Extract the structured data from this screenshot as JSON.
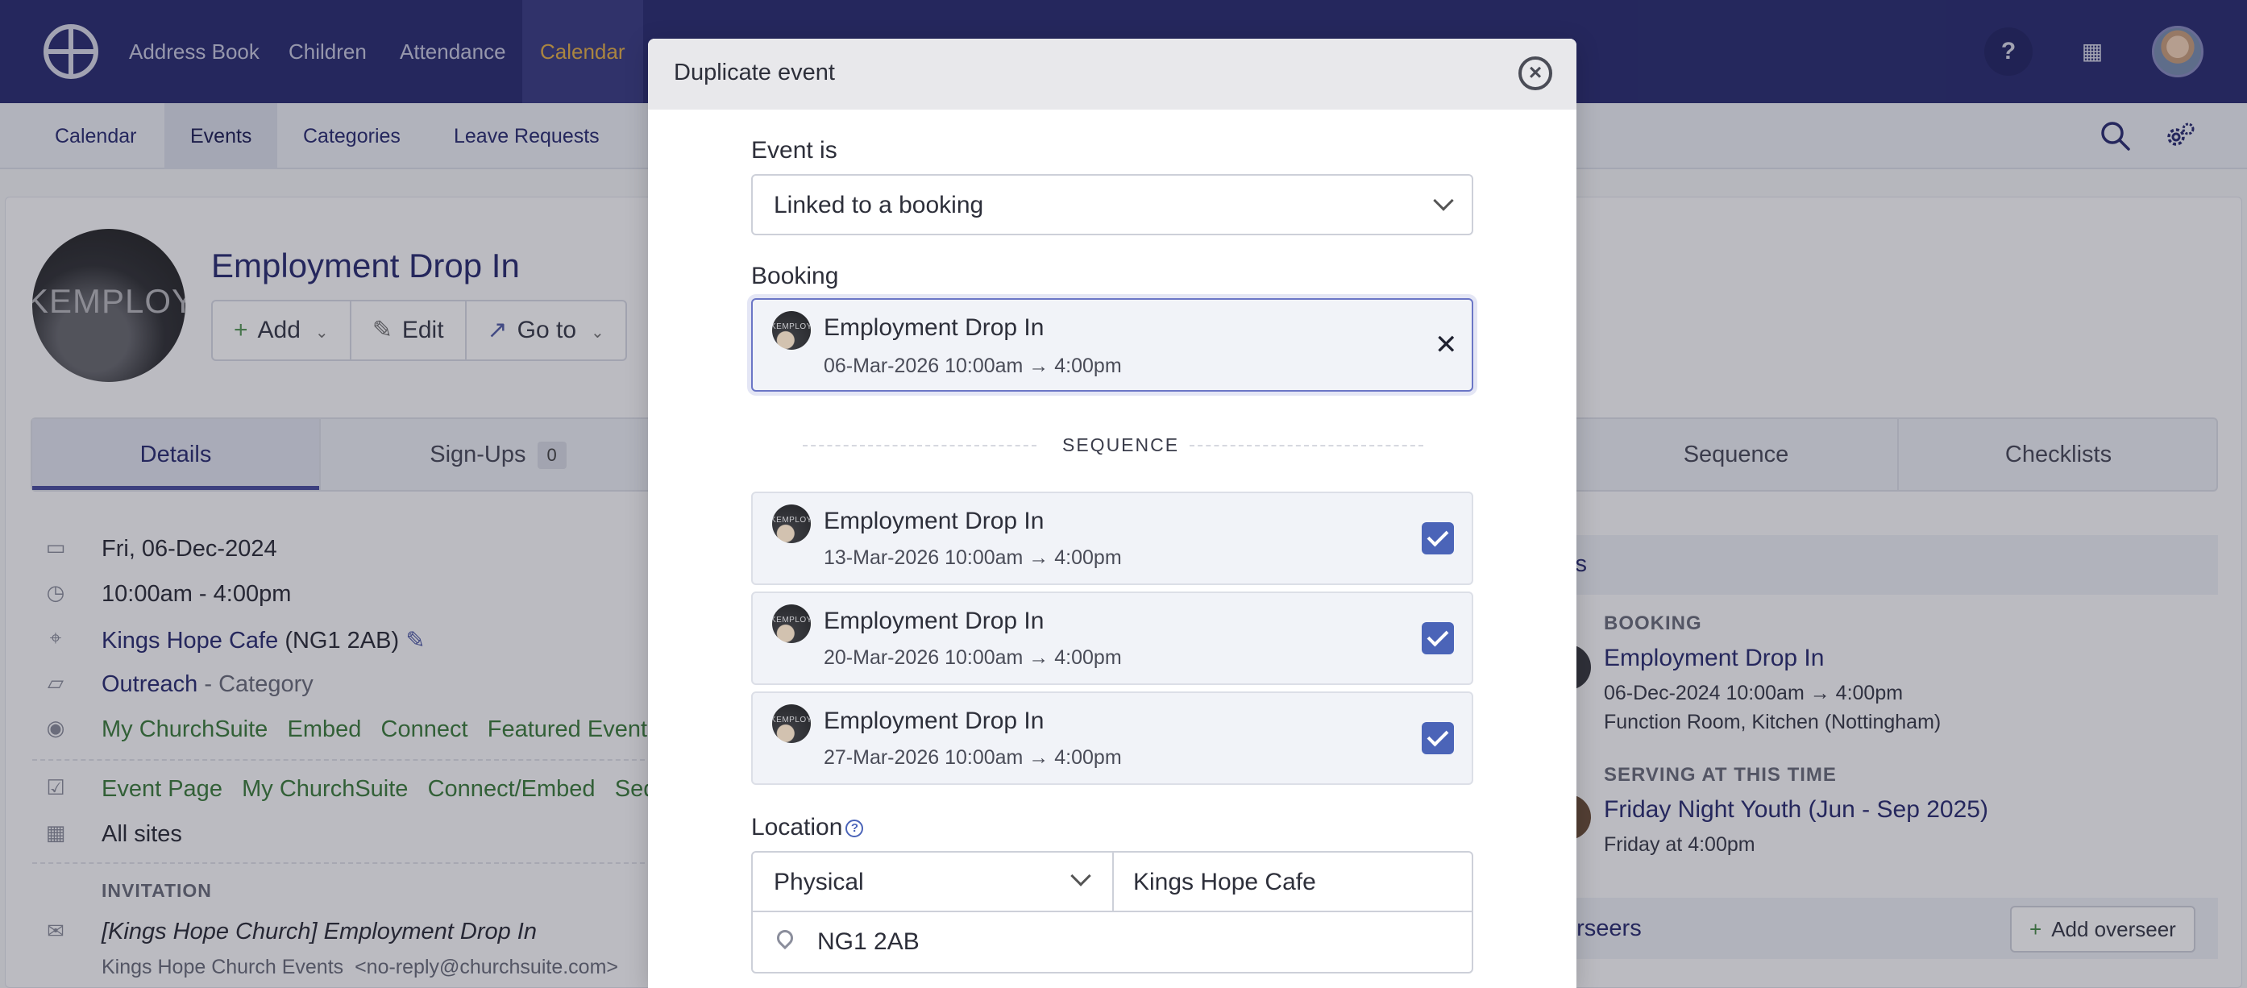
{
  "nav": {
    "items": [
      "Address Book",
      "Children",
      "Attendance",
      "Calendar"
    ],
    "active": "Calendar"
  },
  "subnav": {
    "items": [
      "Calendar",
      "Events",
      "Categories",
      "Leave Requests"
    ],
    "active": "Events"
  },
  "event": {
    "avatar_text": "KEMPLOYE",
    "title": "Employment Drop In",
    "buttons": {
      "add": "Add",
      "edit": "Edit",
      "goto": "Go to"
    }
  },
  "tabs": {
    "details": "Details",
    "signups": "Sign-Ups",
    "signups_count": "0",
    "sequence": "Sequence",
    "checklists": "Checklists"
  },
  "details": {
    "date": "Fri, 06-Dec-2024",
    "time": "10:00am - 4:00pm",
    "location_link": "Kings Hope Cafe",
    "location_postcode": "(NG1 2AB)",
    "category_link": "Outreach",
    "category_suffix": "- Category",
    "visibility": [
      "My ChurchSuite",
      "Embed",
      "Connect",
      "Featured Events"
    ],
    "publish": [
      "Event Page",
      "My ChurchSuite",
      "Connect/Embed",
      "Seq"
    ],
    "sites": "All sites",
    "invitation_label": "INVITATION",
    "invitation_subject": "[Kings Hope Church] Employment Drop In",
    "invitation_from": "Kings Hope Church Events",
    "invitation_email": "<no-reply@churchsuite.com>"
  },
  "right_panel": {
    "links_head": "ks",
    "booking_label": "BOOKING",
    "booking_title": "Employment Drop In",
    "booking_when": "06-Dec-2024 10:00am → 4:00pm",
    "booking_where": "Function Room, Kitchen (Nottingham)",
    "serving_label": "SERVING AT THIS TIME",
    "serving_title": "Friday Night Youth (Jun - Sep 2025)",
    "serving_when": "Friday at 4:00pm",
    "overseers_head": "erseers",
    "add_overseer": "Add overseer"
  },
  "modal": {
    "title": "Duplicate event",
    "event_is_label": "Event is",
    "event_is_value": "Linked to a booking",
    "booking_label": "Booking",
    "booking": {
      "thumb_text": "KEMPLOY",
      "title": "Employment Drop In",
      "when": "06-Mar-2026 10:00am → 4:00pm"
    },
    "sequence_label": "SEQUENCE",
    "sequence": [
      {
        "title": "Employment Drop In",
        "when": "13-Mar-2026 10:00am → 4:00pm",
        "checked": true
      },
      {
        "title": "Employment Drop In",
        "when": "20-Mar-2026 10:00am → 4:00pm",
        "checked": true
      },
      {
        "title": "Employment Drop In",
        "when": "27-Mar-2026 10:00am → 4:00pm",
        "checked": true
      }
    ],
    "location_label": "Location",
    "location_type": "Physical",
    "location_name": "Kings Hope Cafe",
    "location_postcode": "NG1 2AB"
  }
}
